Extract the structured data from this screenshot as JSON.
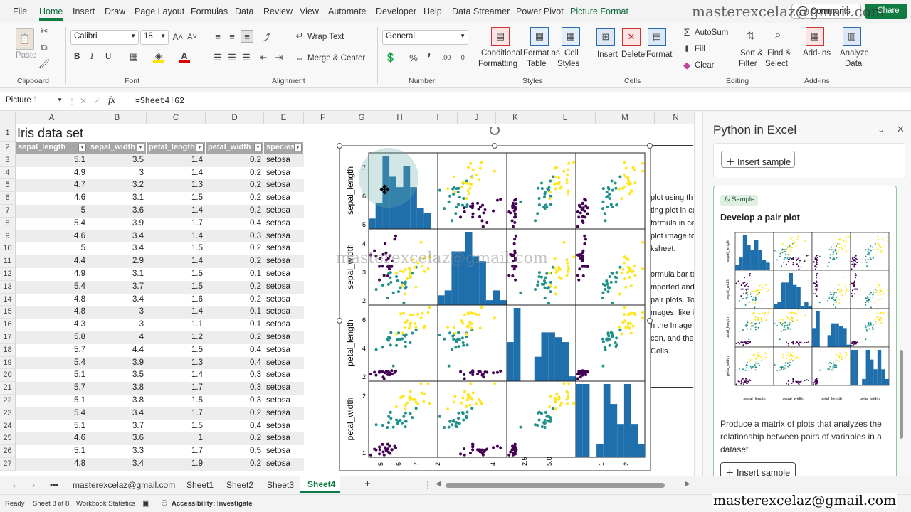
{
  "menu": {
    "items": [
      "File",
      "Home",
      "Insert",
      "Draw",
      "Page Layout",
      "Formulas",
      "Data",
      "Review",
      "View",
      "Automate",
      "Developer",
      "Help",
      "Data Streamer",
      "Power Pivot",
      "Picture Format"
    ],
    "comments": "Comments",
    "share": "Share"
  },
  "ribbon": {
    "clipboard": {
      "paste": "Paste",
      "group": "Clipboard"
    },
    "font": {
      "name": "Calibri",
      "size": "18",
      "group": "Font",
      "bold": "B",
      "italic": "I",
      "underline": "U"
    },
    "alignment": {
      "wrap": "Wrap Text",
      "merge": "Merge & Center",
      "group": "Alignment"
    },
    "number": {
      "format": "General",
      "group": "Number"
    },
    "styles": {
      "cond1": "Conditional",
      "cond2": "Formatting",
      "fmt1": "Format as",
      "fmt2": "Table",
      "cell1": "Cell",
      "cell2": "Styles",
      "group": "Styles"
    },
    "cells": {
      "insert": "Insert",
      "delete": "Delete",
      "format": "Format",
      "group": "Cells"
    },
    "editing": {
      "autosum": "AutoSum",
      "fill": "Fill",
      "clear": "Clear",
      "sort1": "Sort &",
      "sort2": "Filter",
      "find1": "Find &",
      "find2": "Select",
      "group": "Editing"
    },
    "addins": {
      "addins": "Add-ins",
      "group": "Add-ins",
      "analyze1": "Analyze",
      "analyze2": "Data"
    }
  },
  "formula_bar": {
    "name_box": "Picture 1",
    "fx": "fx",
    "formula": "=Sheet4!G2"
  },
  "sheet": {
    "columns": [
      "A",
      "B",
      "C",
      "D",
      "E",
      "F",
      "G",
      "H",
      "I",
      "J",
      "K",
      "L",
      "M",
      "N"
    ],
    "title": "Iris data set",
    "headers": [
      "sepal_length",
      "sepal_width",
      "petal_length",
      "petal_width",
      "species"
    ],
    "rows": [
      [
        "3",
        "5.1",
        "3.5",
        "1.4",
        "0.2",
        "setosa"
      ],
      [
        "4",
        "4.9",
        "3",
        "1.4",
        "0.2",
        "setosa"
      ],
      [
        "5",
        "4.7",
        "3.2",
        "1.3",
        "0.2",
        "setosa"
      ],
      [
        "6",
        "4.6",
        "3.1",
        "1.5",
        "0.2",
        "setosa"
      ],
      [
        "7",
        "5",
        "3.6",
        "1.4",
        "0.2",
        "setosa"
      ],
      [
        "8",
        "5.4",
        "3.9",
        "1.7",
        "0.4",
        "setosa"
      ],
      [
        "9",
        "4.6",
        "3.4",
        "1.4",
        "0.3",
        "setosa"
      ],
      [
        "10",
        "5",
        "3.4",
        "1.5",
        "0.2",
        "setosa"
      ],
      [
        "11",
        "4.4",
        "2.9",
        "1.4",
        "0.2",
        "setosa"
      ],
      [
        "12",
        "4.9",
        "3.1",
        "1.5",
        "0.1",
        "setosa"
      ],
      [
        "13",
        "5.4",
        "3.7",
        "1.5",
        "0.2",
        "setosa"
      ],
      [
        "14",
        "4.8",
        "3.4",
        "1.6",
        "0.2",
        "setosa"
      ],
      [
        "15",
        "4.8",
        "3",
        "1.4",
        "0.1",
        "setosa"
      ],
      [
        "16",
        "4.3",
        "3",
        "1.1",
        "0.1",
        "setosa"
      ],
      [
        "17",
        "5.8",
        "4",
        "1.2",
        "0.2",
        "setosa"
      ],
      [
        "18",
        "5.7",
        "4.4",
        "1.5",
        "0.4",
        "setosa"
      ],
      [
        "19",
        "5.4",
        "3.9",
        "1.3",
        "0.4",
        "setosa"
      ],
      [
        "20",
        "5.1",
        "3.5",
        "1.4",
        "0.3",
        "setosa"
      ],
      [
        "21",
        "5.7",
        "3.8",
        "1.7",
        "0.3",
        "setosa"
      ],
      [
        "22",
        "5.1",
        "3.8",
        "1.5",
        "0.3",
        "setosa"
      ],
      [
        "23",
        "5.4",
        "3.4",
        "1.7",
        "0.2",
        "setosa"
      ],
      [
        "24",
        "5.1",
        "3.7",
        "1.5",
        "0.4",
        "setosa"
      ],
      [
        "25",
        "4.6",
        "3.6",
        "1",
        "0.2",
        "setosa"
      ],
      [
        "26",
        "5.1",
        "3.3",
        "1.7",
        "0.5",
        "setosa"
      ],
      [
        "27",
        "4.8",
        "3.4",
        "1.9",
        "0.2",
        "setosa"
      ]
    ],
    "side_text": [
      "plot using th",
      "ting plot in ce",
      "formula in ce",
      "plot image to",
      "ksheet.",
      "",
      "ormula bar to",
      "mported and",
      "pair plots. To",
      "mages, like in",
      "h the Image",
      "con, and ther",
      "Cells."
    ]
  },
  "pairplot": {
    "vars": [
      "sepal_length",
      "sepal_width",
      "petal_length",
      "petal_width"
    ],
    "yticks": [
      [
        "7",
        "6",
        "5"
      ],
      [
        "4",
        "3",
        "2"
      ],
      [
        "6",
        "4",
        "2"
      ],
      [
        "2",
        "1"
      ]
    ],
    "xticks": [
      "5",
      "6",
      "7",
      "2",
      "4",
      "2.5",
      "5.0",
      "1",
      "2"
    ],
    "colors": {
      "setosa": "#440154",
      "versicolor": "#21918c",
      "virginica": "#fde725",
      "hist": "#1f6fad"
    }
  },
  "panel": {
    "title": "Python in Excel",
    "insert_sample": "Insert sample",
    "badge": "Sample",
    "card_title": "Develop a pair plot",
    "mini_labels": [
      "sepal_length",
      "sepal_width",
      "petal_length",
      "petal_width"
    ],
    "description": "Produce a matrix of plots that analyzes the relationship between pairs of variables in a dataset.",
    "insert_button": "Insert sample"
  },
  "tabs": {
    "items": [
      "masterexcelaz@gmail.com",
      "Sheet1",
      "Sheet2",
      "Sheet3",
      "Sheet4"
    ],
    "active": "Sheet4",
    "more": "•••",
    "add": "+"
  },
  "status": {
    "ready": "Ready",
    "sheet": "Sheet 8 of 8",
    "stats": "Workbook Statistics",
    "access": "Accessibility: Investigate"
  },
  "watermark": "masterexcelaz@gmail.com"
}
